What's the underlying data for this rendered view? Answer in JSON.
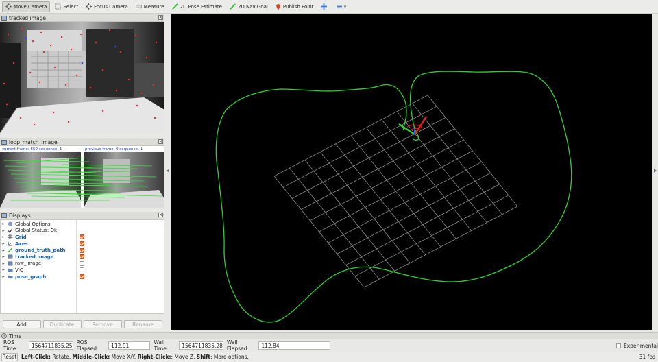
{
  "toolbar": {
    "tools": [
      {
        "label": "Move Camera",
        "icon": "move-camera-icon"
      },
      {
        "label": "Select",
        "icon": "select-icon"
      },
      {
        "label": "Focus Camera",
        "icon": "focus-camera-icon"
      },
      {
        "label": "Measure",
        "icon": "measure-icon"
      },
      {
        "label": "2D Pose Estimate",
        "icon": "pose-estimate-icon"
      },
      {
        "label": "2D Nav Goal",
        "icon": "nav-goal-icon"
      },
      {
        "label": "Publish Point",
        "icon": "publish-point-icon"
      }
    ]
  },
  "panels": {
    "tracked_image_title": "tracked image",
    "loop_match_title": "loop_match_image",
    "loop_match_current": "current frame: 650   sequence: 1",
    "loop_match_previous": "previous frame: 0   sequence: 1",
    "displays_title": "Displays"
  },
  "displays": [
    {
      "label": "Global Options",
      "checked": null,
      "blue": false,
      "icon": "globe-icon"
    },
    {
      "label": "Global Status: Ok",
      "checked": null,
      "blue": false,
      "icon": "check-icon"
    },
    {
      "label": "Grid",
      "checked": true,
      "blue": true,
      "icon": "grid-icon"
    },
    {
      "label": "Axes",
      "checked": true,
      "blue": true,
      "icon": "axes-icon"
    },
    {
      "label": "ground_truth_path",
      "checked": true,
      "blue": true,
      "icon": "path-icon"
    },
    {
      "label": "tracked image",
      "checked": true,
      "blue": true,
      "icon": "image-icon"
    },
    {
      "label": "raw_image",
      "checked": false,
      "blue": false,
      "icon": "image-icon"
    },
    {
      "label": "VIO",
      "checked": false,
      "blue": false,
      "icon": "folder-icon"
    },
    {
      "label": "pose_graph",
      "checked": true,
      "blue": true,
      "icon": "folder-icon"
    }
  ],
  "buttons": {
    "add": "Add",
    "duplicate": "Duplicate",
    "remove": "Remove",
    "rename": "Rename"
  },
  "time": {
    "title": "Time",
    "ros_time_label": "ROS Time:",
    "ros_time": "1564711835.25",
    "ros_elapsed_label": "ROS Elapsed:",
    "ros_elapsed": "112.91",
    "wall_time_label": "Wall Time:",
    "wall_time": "1564711835.28",
    "wall_elapsed_label": "Wall Elapsed:",
    "wall_elapsed": "112.84",
    "experimental_label": "Experimental"
  },
  "status": {
    "reset": "Reset",
    "left_click": "Left-Click:",
    "left_click_desc": " Rotate. ",
    "middle_click": "Middle-Click:",
    "middle_click_desc": " Move X/Y. ",
    "right_click": "Right-Click:",
    "right_click_desc": ": Move Z. ",
    "shift": "Shift",
    "shift_desc": ": More options.",
    "fps": "31 fps"
  },
  "colors": {
    "path": "#2fd12f",
    "grid": "#9a9a9a",
    "accent_check": "#e9692c",
    "link_blue": "#1d62b5"
  }
}
